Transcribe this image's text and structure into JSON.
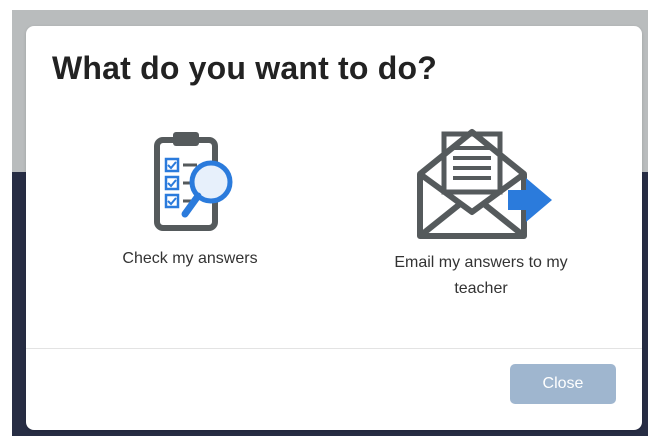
{
  "dialog": {
    "title": "What do you want to do?",
    "options": [
      {
        "label": "Check my answers",
        "icon": "clipboard-magnifier-icon"
      },
      {
        "label": "Email my answers to my teacher",
        "icon": "envelope-send-icon"
      }
    ],
    "close_label": "Close"
  },
  "colors": {
    "icon_gray": "#555a5c",
    "icon_blue": "#2b7bdc",
    "close_button": "#9fb6cf",
    "backdrop_light": "#b9bcbd",
    "backdrop_dark": "#272d44"
  }
}
